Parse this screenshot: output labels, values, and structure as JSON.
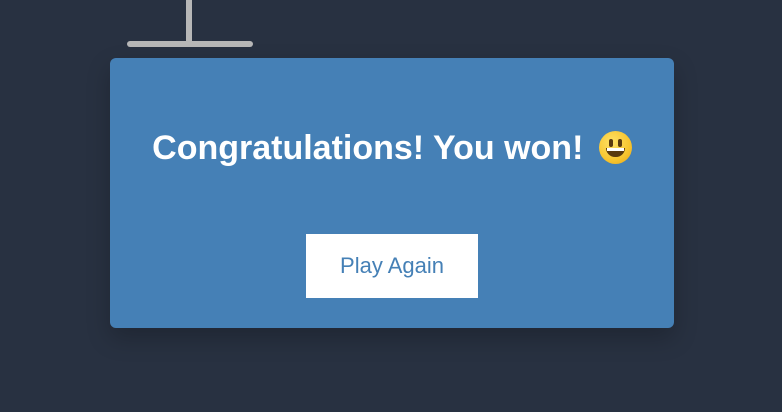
{
  "game": {
    "message": "Congratulations! You won!",
    "emoji_icon": "grinning-face-icon",
    "play_again_label": "Play Again"
  },
  "colors": {
    "background": "#283141",
    "popup": "#4580b6",
    "gallows": "#b7b7b7",
    "button_text": "#4580b6"
  }
}
